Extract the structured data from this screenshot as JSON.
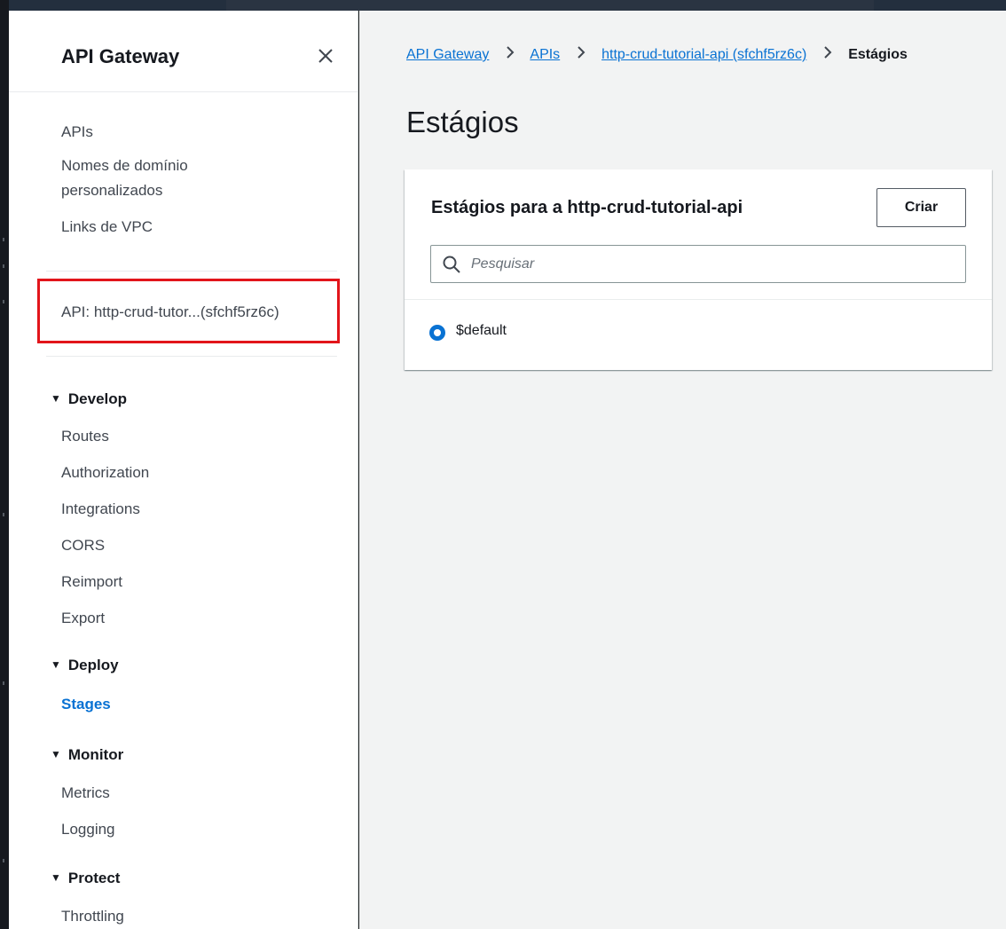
{
  "sidebar": {
    "title": "API Gateway",
    "top_links": [
      "APIs",
      "Nomes de domínio",
      "personalizados",
      "Links de VPC"
    ],
    "api_label": "API: http-crud-tutor...(sfchf5rz6c)",
    "sections": [
      {
        "label": "Develop",
        "items": [
          "Routes",
          "Authorization",
          "Integrations",
          "CORS",
          "Reimport",
          "Export"
        ]
      },
      {
        "label": "Deploy",
        "items": [
          "Stages"
        ]
      },
      {
        "label": "Monitor",
        "items": [
          "Metrics",
          "Logging"
        ]
      },
      {
        "label": "Protect",
        "items": [
          "Throttling"
        ]
      }
    ],
    "active_item": "Stages",
    "active_color": "#0972d3",
    "highlight_color": "#e2151b"
  },
  "breadcrumb": {
    "items": [
      "API Gateway",
      "APIs",
      "http-crud-tutorial-api (sfchf5rz6c)"
    ],
    "current": "Estágios"
  },
  "main": {
    "title": "Estágios",
    "panel": {
      "title": "Estágios para a http-crud-tutorial-api",
      "create_button": "Criar",
      "search_placeholder": "Pesquisar",
      "stages": [
        {
          "name": "$default",
          "selected": true
        }
      ]
    }
  }
}
